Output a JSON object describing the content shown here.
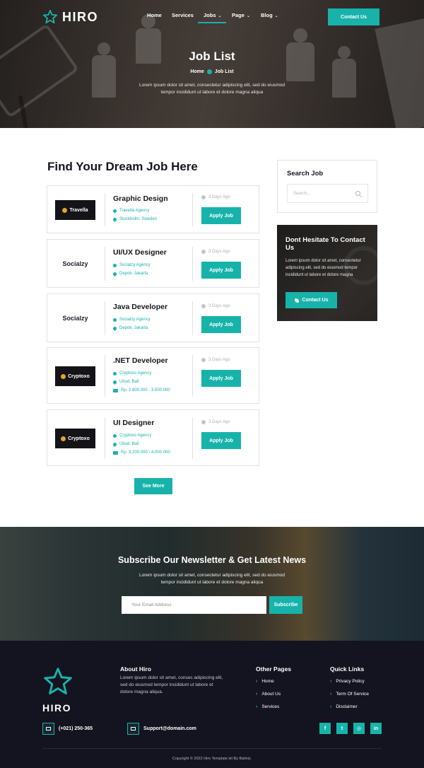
{
  "header": {
    "brand": "HIRO",
    "nav": [
      {
        "label": "Home",
        "has_caret": false
      },
      {
        "label": "Services",
        "has_caret": false
      },
      {
        "label": "Jobs",
        "has_caret": true,
        "active": true
      },
      {
        "label": "Page",
        "has_caret": true
      },
      {
        "label": "Blog",
        "has_caret": true
      }
    ],
    "contact_button": "Contact Us"
  },
  "hero": {
    "title": "Job List",
    "breadcrumb": {
      "home": "Home",
      "current": "Job List"
    },
    "description": "Lorem ipsum dolor sit amet, consectetur adipiscing elit, sed do eiusmod tempor incididunt ut labore et dolore magna aliqua"
  },
  "main": {
    "section_title": "Find Your Dream Job Here",
    "jobs": [
      {
        "company_logo": "Travella",
        "logo_style": "dark",
        "title": "Graphic Design",
        "agency": "Travella Agency",
        "location": "Stockholm, Sweden",
        "salary": null,
        "posted": "3 Days Ago",
        "apply_label": "Apply Job"
      },
      {
        "company_logo": "Socialzy",
        "logo_style": "light",
        "title": "UI/UX Designer",
        "agency": "Socialzy Agency",
        "location": "Depok, Jakarta",
        "salary": null,
        "posted": "3 Days Ago",
        "apply_label": "Apply Job"
      },
      {
        "company_logo": "Socialzy",
        "logo_style": "light",
        "title": "Java Developer",
        "agency": "Socialzy Agency",
        "location": "Depok, Jakarta",
        "salary": null,
        "posted": "3 Days Ago",
        "apply_label": "Apply Job"
      },
      {
        "company_logo": "Cryptoxo",
        "logo_style": "dark",
        "title": ".NET Developer",
        "agency": "Cryptoxo Agency",
        "location": "Ubud, Bali",
        "salary": "Rp. 2.800.000 - 3.500.000",
        "posted": "3 Days Ago",
        "apply_label": "Apply Job"
      },
      {
        "company_logo": "Cryptoxo",
        "logo_style": "dark",
        "title": "UI Designer",
        "agency": "Cryptoxo Agency",
        "location": "Ubud, Bali",
        "salary": "Rp. 3.200.000 - 4.000.000",
        "posted": "3 Days Ago",
        "apply_label": "Apply Job"
      }
    ],
    "see_more": "See More"
  },
  "sidebar": {
    "search": {
      "title": "Search Job",
      "placeholder": "Search..."
    },
    "contact": {
      "title": "Dont Hesitate To Contact Us",
      "description": "Lorem ipsum dolor sit amet, consectetur adipiscing elit, sed do eiusmod tempor incididunt ut labore et dolore magna",
      "button": "Contact Us"
    }
  },
  "newsletter": {
    "title": "Subscribe Our Newsletter & Get Latest News",
    "description": "Lorem ipsum dolor sit amet, consectetur adipiscing elit, sed do eiusmod tempor incididunt ut labore et dolore magna aliqua",
    "placeholder": "Your Email Address",
    "button": "Subscribe"
  },
  "footer": {
    "brand": "HIRO",
    "about_title": "About Hiro",
    "about_text": "Lorem ipsum dolor sit amet, consec adipiscing elit, sed do eiusmod tempor incididunt ut labore et dolore magna aliqua.",
    "other_pages_title": "Other Pages",
    "other_pages": [
      "Home",
      "About Us",
      "Services"
    ],
    "quick_links_title": "Quick Links",
    "quick_links": [
      "Privacy Policy",
      "Term Of Service",
      "Disclaimer"
    ],
    "phone": "(+021) 250-365",
    "email": "Support@domain.com",
    "socials": [
      "facebook-icon",
      "twitter-icon",
      "instagram-icon",
      "linkedin-icon"
    ],
    "copyright": "Copyright © 2022 Hiro Template kit By Baliniz."
  },
  "colors": {
    "accent": "#17b3aa",
    "dark": "#141320"
  }
}
